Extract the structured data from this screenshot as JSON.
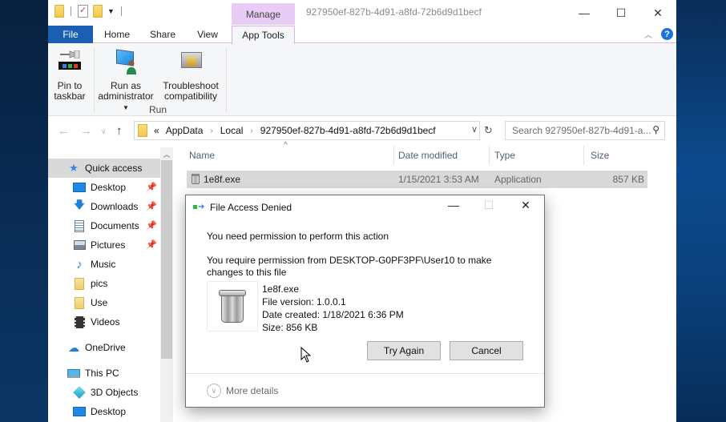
{
  "window": {
    "title": "927950ef-827b-4d91-a8fd-72b6d9d1becf",
    "contextual_tab_group": "Manage",
    "controls": {
      "minimize": "—",
      "maximize": "☐",
      "close": "✕"
    }
  },
  "ribbon": {
    "tabs": [
      {
        "label": "File",
        "active": false
      },
      {
        "label": "Home",
        "active": false
      },
      {
        "label": "Share",
        "active": false
      },
      {
        "label": "View",
        "active": false
      },
      {
        "label": "App Tools",
        "active": true
      }
    ],
    "buttons": {
      "pin": {
        "line1": "Pin to",
        "line2": "taskbar"
      },
      "run_admin": {
        "line1": "Run as",
        "line2": "administrator"
      },
      "troubleshoot": {
        "line1": "Troubleshoot",
        "line2": "compatibility"
      }
    },
    "group_label": "Run",
    "help": "?"
  },
  "address_bar": {
    "overflow": "«",
    "breadcrumbs": [
      "AppData",
      "Local",
      "927950ef-827b-4d91-a8fd-72b6d9d1becf"
    ],
    "search_placeholder": "Search 927950ef-827b-4d91-a..."
  },
  "nav_pane": {
    "items": [
      {
        "label": "Quick access",
        "icon": "star-icon",
        "selected": true,
        "pinned": false
      },
      {
        "label": "Desktop",
        "icon": "desktop-icon",
        "pinned": true
      },
      {
        "label": "Downloads",
        "icon": "download-icon",
        "pinned": true
      },
      {
        "label": "Documents",
        "icon": "document-icon",
        "pinned": true
      },
      {
        "label": "Pictures",
        "icon": "pictures-icon",
        "pinned": true
      },
      {
        "label": "Music",
        "icon": "music-icon",
        "pinned": false
      },
      {
        "label": "pics",
        "icon": "folder-icon",
        "pinned": false
      },
      {
        "label": "Use",
        "icon": "folder-icon",
        "pinned": false
      },
      {
        "label": "Videos",
        "icon": "videos-icon",
        "pinned": false
      },
      {
        "label": "OneDrive",
        "icon": "cloud-icon",
        "pinned": false
      },
      {
        "label": "This PC",
        "icon": "computer-icon",
        "pinned": false
      },
      {
        "label": "3D Objects",
        "icon": "cube-icon",
        "pinned": false
      },
      {
        "label": "Desktop",
        "icon": "desktop-icon",
        "pinned": false
      }
    ]
  },
  "file_list": {
    "columns": [
      "Name",
      "Date modified",
      "Type",
      "Size"
    ],
    "rows": [
      {
        "name": "1e8f.exe",
        "date_modified": "1/15/2021 3:53 AM",
        "type": "Application",
        "size": "857 KB"
      }
    ]
  },
  "dialog": {
    "title": "File Access Denied",
    "message_primary": "You need permission to perform this action",
    "message_secondary": "You require permission from DESKTOP-G0PF3PF\\User10 to make changes to this file",
    "file": {
      "name": "1e8f.exe",
      "version": "File version: 1.0.0.1",
      "date_created": "Date created: 1/18/2021 6:36 PM",
      "size": "Size: 856 KB"
    },
    "buttons": {
      "try_again": "Try Again",
      "cancel": "Cancel"
    },
    "more_details": "More details",
    "controls": {
      "minimize": "—",
      "maximize": "☐",
      "close": "✕"
    }
  },
  "colors": {
    "file_tab": "#1a5fb4",
    "manage_tab": "#e8ccf5",
    "selection": "#d9d9d9",
    "help_icon": "#1a73d9"
  }
}
